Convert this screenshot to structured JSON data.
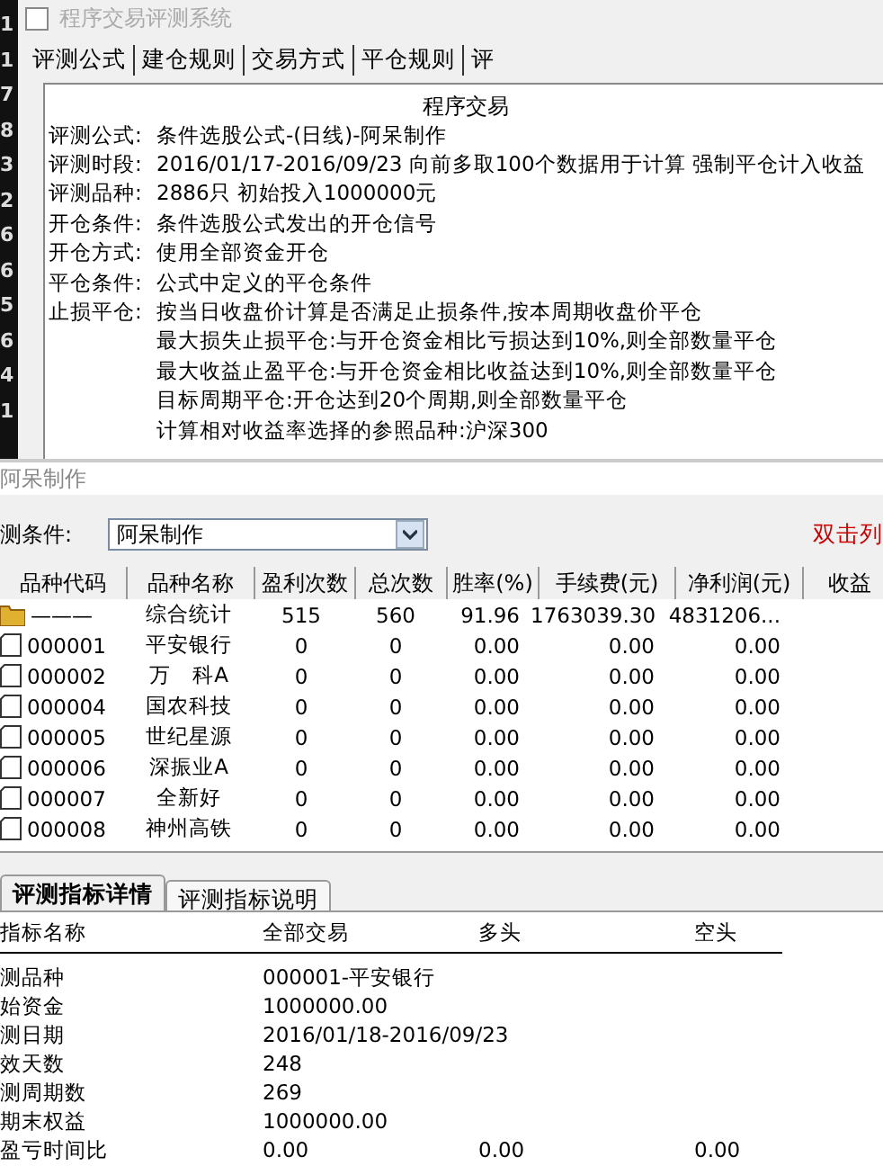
{
  "side_digits": [
    "1",
    "1",
    "7",
    "8",
    "3",
    "2",
    "6",
    "6",
    "5",
    "6",
    "4",
    "1"
  ],
  "top_window": {
    "title": "程序交易评测系统",
    "tabs": [
      "评测公式",
      "建仓规则",
      "交易方式",
      "平仓规则",
      "评"
    ],
    "report_heading": "程序交易",
    "report_lines": [
      {
        "label": "评测公式:",
        "value": "条件选股公式-(日线)-阿呆制作"
      },
      {
        "label": "评测时段:",
        "value": "2016/01/17-2016/09/23 向前多取100个数据用于计算 强制平仓计入收益"
      },
      {
        "label": "评测品种:",
        "value": "2886只 初始投入1000000元"
      },
      {
        "label": "开仓条件:",
        "value": "条件选股公式发出的开仓信号"
      },
      {
        "label": "开仓方式:",
        "value": "使用全部资金开仓"
      },
      {
        "label": "平仓条件:",
        "value": "公式中定义的平仓条件"
      },
      {
        "label": "止损平仓:",
        "value": "按当日收盘价计算是否满足止损条件,按本周期收盘价平仓"
      },
      {
        "value": "最大损失止损平仓:与开仓资金相比亏损达到10%,则全部数量平仓"
      },
      {
        "value": "最大收益止盈平仓:与开仓资金相比收益达到10%,则全部数量平仓"
      },
      {
        "value": "目标周期平仓:开仓达到20个周期,则全部数量平仓"
      },
      {
        "value": "计算相对收益率选择的参照品种:沪深300"
      }
    ]
  },
  "main_window": {
    "title": "阿呆制作",
    "condition_label": "测条件:",
    "condition_select": "阿呆制作",
    "hint": "双击列",
    "table": {
      "columns": [
        "品种代码",
        "品种名称",
        "盈利次数",
        "总次数",
        "胜率(%)",
        "手续费(元)",
        "净利润(元)",
        "收益"
      ],
      "rows": [
        {
          "kind": "summary",
          "cells": [
            "———",
            "综合统计",
            "515",
            "560",
            "91.96",
            "1763039.30",
            "4831206..."
          ]
        },
        {
          "kind": "stock",
          "cells": [
            "000001",
            "平安银行",
            "0",
            "0",
            "0.00",
            "0.00",
            "0.00"
          ]
        },
        {
          "kind": "stock",
          "cells": [
            "000002",
            "万　科A",
            "0",
            "0",
            "0.00",
            "0.00",
            "0.00"
          ]
        },
        {
          "kind": "stock",
          "cells": [
            "000004",
            "国农科技",
            "0",
            "0",
            "0.00",
            "0.00",
            "0.00"
          ]
        },
        {
          "kind": "stock",
          "cells": [
            "000005",
            "世纪星源",
            "0",
            "0",
            "0.00",
            "0.00",
            "0.00"
          ]
        },
        {
          "kind": "stock",
          "cells": [
            "000006",
            "深振业A",
            "0",
            "0",
            "0.00",
            "0.00",
            "0.00"
          ]
        },
        {
          "kind": "stock",
          "cells": [
            "000007",
            "全新好",
            "0",
            "0",
            "0.00",
            "0.00",
            "0.00"
          ]
        },
        {
          "kind": "stock",
          "cells": [
            "000008",
            "神州高铁",
            "0",
            "0",
            "0.00",
            "0.00",
            "0.00"
          ]
        }
      ]
    },
    "detail_tabs": [
      {
        "label": "评测指标详情",
        "selected": true
      },
      {
        "label": "评测指标说明",
        "selected": false
      }
    ],
    "detail_table": {
      "columns": [
        "指标名称",
        "全部交易",
        "多头",
        "空头"
      ],
      "rows": [
        [
          "测品种",
          "000001-平安银行"
        ],
        [
          "始资金",
          "1000000.00"
        ],
        [
          "测日期",
          "2016/01/18-2016/09/23"
        ],
        [
          "效天数",
          "248"
        ],
        [
          "测周期数",
          "269"
        ],
        [
          "期末权益",
          "1000000.00"
        ],
        [
          "盈亏时间比",
          "0.00",
          "0.00",
          "0.00"
        ]
      ]
    }
  }
}
